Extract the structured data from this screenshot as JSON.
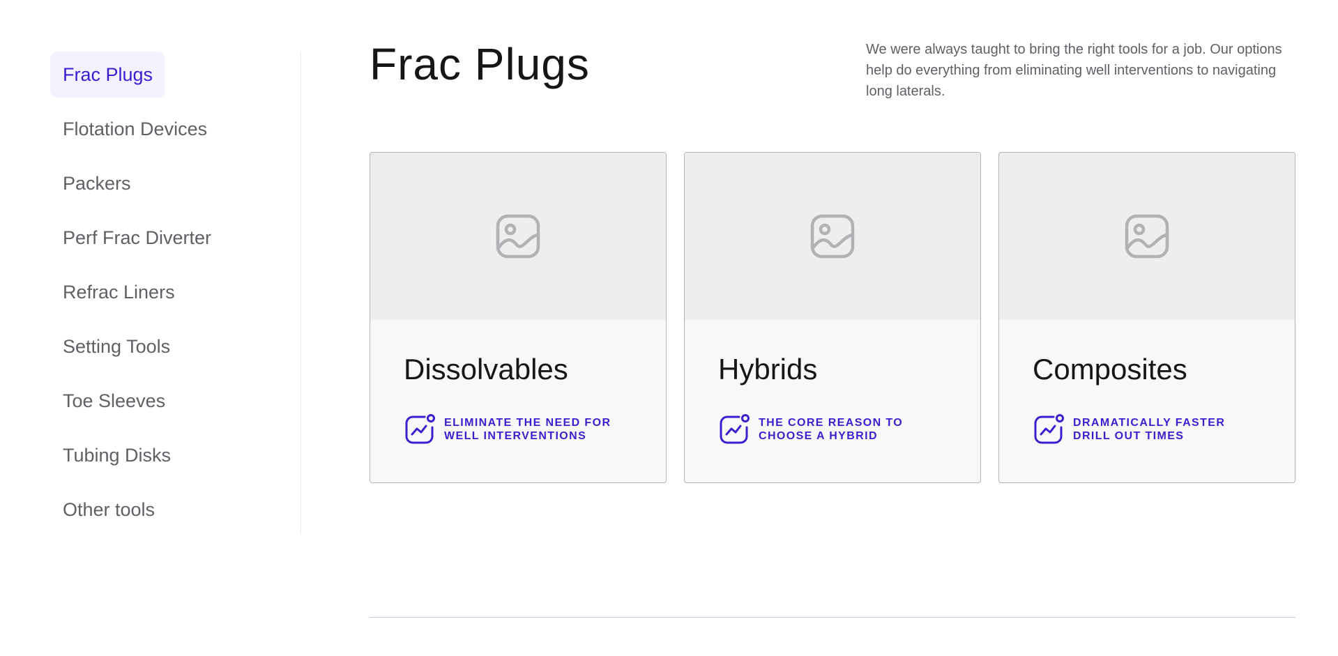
{
  "sidebar": {
    "items": [
      {
        "label": "Frac Plugs"
      },
      {
        "label": "Flotation Devices"
      },
      {
        "label": "Packers"
      },
      {
        "label": "Perf Frac Diverter"
      },
      {
        "label": "Refrac Liners"
      },
      {
        "label": "Setting Tools"
      },
      {
        "label": "Toe Sleeves"
      },
      {
        "label": "Tubing Disks"
      },
      {
        "label": "Other tools"
      }
    ],
    "active_index": 0
  },
  "main": {
    "title": "Frac Plugs",
    "intro": "We were always taught to bring the right tools for a job. Our options help do everything from eliminating well interventions to navigating long laterals.",
    "cards": [
      {
        "title": "Dissolvables",
        "feature": "ELIMINATE THE NEED FOR WELL INTERVENTIONS",
        "image_icon": "image-placeholder-icon",
        "feature_icon": "trend-chart-icon"
      },
      {
        "title": "Hybrids",
        "feature": "THE CORE REASON TO CHOOSE A HYBRID",
        "image_icon": "image-placeholder-icon",
        "feature_icon": "trend-chart-icon"
      },
      {
        "title": "Composites",
        "feature": "DRAMATICALLY FASTER DRILL OUT TIMES",
        "image_icon": "image-placeholder-icon",
        "feature_icon": "trend-chart-icon"
      }
    ]
  },
  "colors": {
    "accent": "#3a1fd1",
    "active_bg": "#f4f2ff",
    "text_muted": "#5f5f66",
    "card_media_bg": "#eeeeee",
    "card_body_bg": "#f8f8f8",
    "placeholder_icon": "#b2b2b6",
    "divider": "#c9c9e6"
  }
}
